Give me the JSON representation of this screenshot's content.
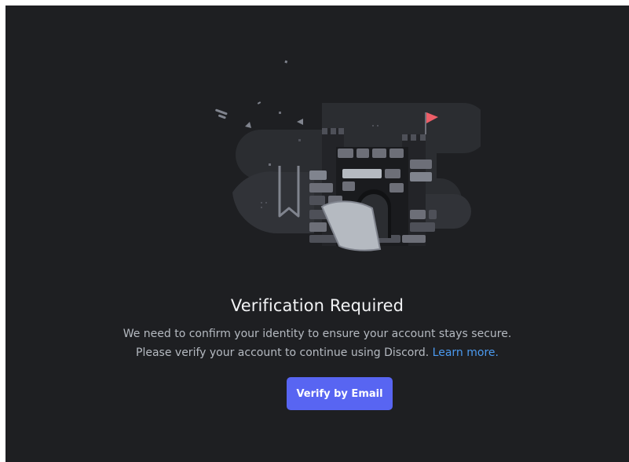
{
  "illustration": {
    "icon": "castle-verification-illustration",
    "flag_color": "#ed5e68",
    "accent_color": "#5865f2"
  },
  "main": {
    "title": "Verification Required",
    "description_line1": "We need to confirm your identity to ensure your account stays secure.",
    "description_line2": "Please verify your account to continue using Discord.",
    "learn_more_label": "Learn more.",
    "verify_button_label": "Verify by Email"
  },
  "colors": {
    "background": "#1e1f22",
    "title": "#f2f3f5",
    "body_text": "#b5bac1",
    "link": "#4b9af0",
    "button": "#5865f2"
  }
}
